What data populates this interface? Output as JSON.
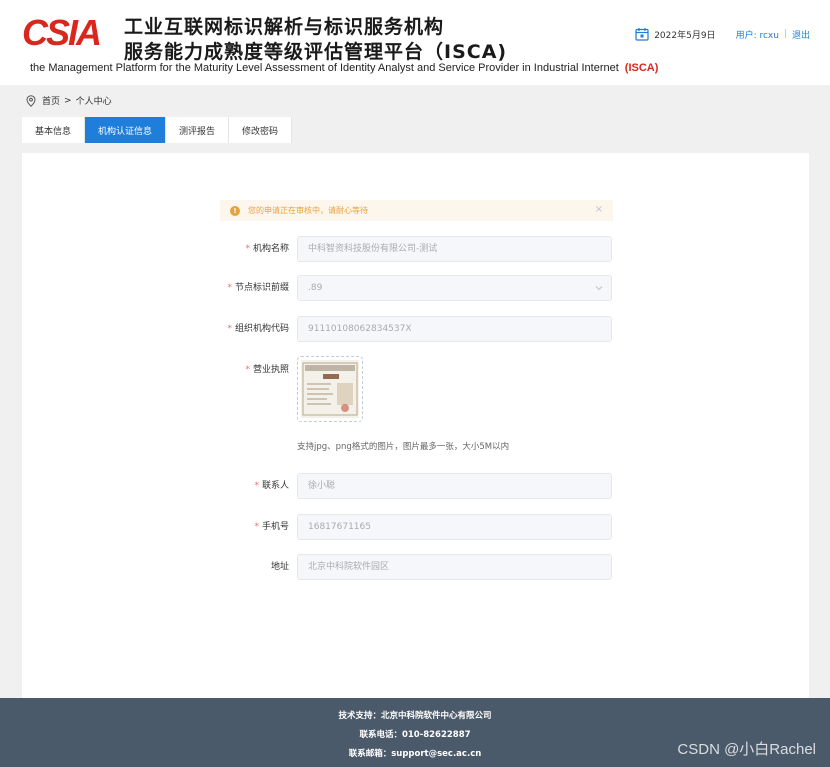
{
  "header": {
    "logo_text": "CSIA",
    "title_line1": "工业互联网标识解析与标识服务机构",
    "title_line2": "服务能力成熟度等级评估管理平台（ISCA)",
    "subtitle": "the Management Platform for the Maturity Level Assessment of Identity Analyst and Service Provider in Industrial Internet",
    "subtitle_tag": "(ISCA)",
    "date": "2022年5月9日",
    "user_label": "用户: rcxu",
    "separator": "|",
    "logout": "退出"
  },
  "breadcrumb": {
    "home": "首页",
    "sep": ">",
    "current": "个人中心"
  },
  "tabs": [
    {
      "label": "基本信息",
      "active": false
    },
    {
      "label": "机构认证信息",
      "active": true
    },
    {
      "label": "测评报告",
      "active": false
    },
    {
      "label": "修改密码",
      "active": false
    }
  ],
  "alert": {
    "icon": "!",
    "text": "您的申请正在审核中，请耐心等待",
    "close": "×"
  },
  "form": {
    "org_name": {
      "label": "机构名称",
      "required_mark": "*",
      "value": "中科智资科技股份有限公司-测试"
    },
    "node_prefix": {
      "label": "节点标识前缀",
      "required_mark": "*",
      "value": ".89"
    },
    "org_code": {
      "label": "组织机构代码",
      "required_mark": "*",
      "value": "911101080628345​37X"
    },
    "license": {
      "label": "营业执照",
      "required_mark": "*",
      "hint": "支持jpg、png格式的图片，图片最多一张，大小5M以内"
    },
    "contact": {
      "label": "联系人",
      "required_mark": "*",
      "value": "徐小聪"
    },
    "phone": {
      "label": "手机号",
      "required_mark": "*",
      "value": "16817671165"
    },
    "address": {
      "label": "地址",
      "value": "北京中科院软件园区"
    }
  },
  "footer": {
    "support": "技术支持：北京中科院软件中心有限公司",
    "phone": "联系电话：010-82622887",
    "email": "联系邮箱：support@sec.ac.cn"
  },
  "watermark": "CSDN @小白Rachel",
  "colors": {
    "accent": "#1e7ed9",
    "brand_red": "#d9271e",
    "footer_bg": "#4b5a6a",
    "warning": "#e6a23c"
  }
}
